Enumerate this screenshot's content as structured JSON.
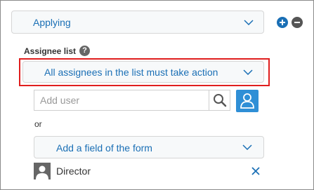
{
  "status_select": {
    "value": "Applying"
  },
  "controls": {
    "add_symbol": "+",
    "remove_symbol": "−"
  },
  "assignee": {
    "section_label": "Assignee list",
    "help_symbol": "?",
    "mode_select": {
      "value": "All assignees in the list must take action"
    },
    "user_input": {
      "placeholder": "Add user",
      "value": ""
    },
    "or_label": "or",
    "field_select": {
      "value": "Add a field of the form"
    },
    "list": [
      {
        "name": "Director"
      }
    ]
  },
  "colors": {
    "accent": "#1a6fb5",
    "highlight": "#e01e1e",
    "button_blue": "#2f8fd6"
  },
  "icons": [
    "chevron-down-icon",
    "plus-icon",
    "minus-icon",
    "help-icon",
    "search-icon",
    "user-icon",
    "close-icon"
  ]
}
